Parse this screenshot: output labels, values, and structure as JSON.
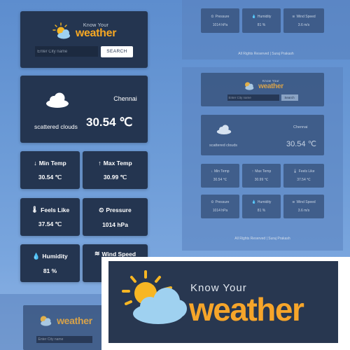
{
  "app": {
    "logo_small": "Know Your",
    "logo_big": "weather"
  },
  "search": {
    "placeholder": "Enter City name",
    "button_label": "SEARCH"
  },
  "current": {
    "city": "Chennai",
    "description": "scattered clouds",
    "temperature": "30.54 ℃"
  },
  "stats": {
    "min_temp": {
      "label": "Min Temp",
      "value": "30.54 ℃"
    },
    "max_temp": {
      "label": "Max Temp",
      "value": "30.99 ℃"
    },
    "feels_like": {
      "label": "Feels Like",
      "value": "37.54 ℃"
    },
    "pressure": {
      "label": "Pressure",
      "value": "1014 hPa"
    },
    "humidity": {
      "label": "Humidity",
      "value": "81 %"
    },
    "wind_speed": {
      "label": "Wind Speed",
      "value": ""
    }
  },
  "desktop": {
    "search_button_label": "Search",
    "feels_like_value": "37.54 ℃",
    "humidity_value": "81 %",
    "wind_value": "3.6 m/s",
    "footer": "All Rights Reserved | Suraj Prakash"
  },
  "colors": {
    "background": "#6b9ad6",
    "card": "#243550",
    "accent": "#f7a823"
  }
}
